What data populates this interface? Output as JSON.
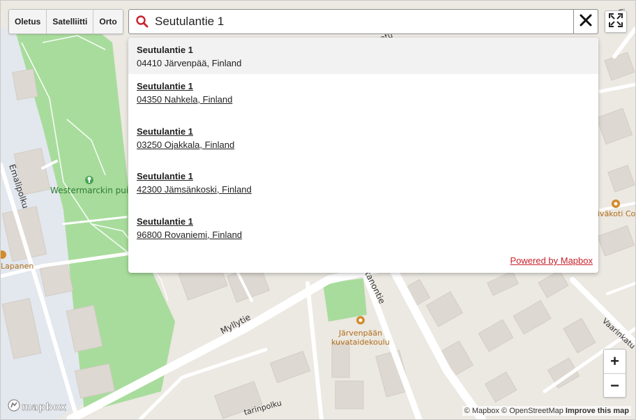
{
  "layers": [
    {
      "label": "Oletus"
    },
    {
      "label": "Satelliitti"
    },
    {
      "label": "Orto"
    }
  ],
  "search": {
    "value": "Seutulantie 1",
    "icon": "search-icon",
    "clear_icon": "close-icon"
  },
  "results": [
    {
      "name": "Seutulantie 1",
      "address": "04410 Järvenpää, Finland"
    },
    {
      "name": "Seutulantie 1",
      "address": "04350 Nahkela, Finland"
    },
    {
      "name": "Seutulantie 1",
      "address": "03250 Ojakkala, Finland"
    },
    {
      "name": "Seutulantie 1",
      "address": "42300 Jämsänkoski, Finland"
    },
    {
      "name": "Seutulantie 1",
      "address": "96800 Rovaniemi, Finland"
    }
  ],
  "powered_by": "Powered by Mapbox",
  "zoom": {
    "in": "+",
    "out": "−"
  },
  "map_labels": {
    "street_emali": "Emalipolku",
    "park": "Westermarckin puisto",
    "street_myllytie": "Myllytie",
    "street_kartano": "rtanontie",
    "school_line1": "Järvenpään",
    "school_line2": "kuvataidekoulu",
    "kindergarten": "iväkoti Coc",
    "lapanen": "Lapanen",
    "street_vaarin": "Vaarinkatu",
    "street_tarin": "tarinpolku",
    "street_top": "inkatu",
    "street_top_mid": "atu"
  },
  "colors": {
    "park": "#a8dc9c",
    "road": "#ffffff",
    "building": "#ddd8d1",
    "block": "#e3e7ee",
    "poi": "#d38b2c",
    "accent": "#c8232c"
  },
  "brand": {
    "logo_text": "mapbox"
  },
  "attribution": {
    "mapbox": "© Mapbox",
    "osm": "© OpenStreetMap",
    "improve": "Improve this map"
  }
}
